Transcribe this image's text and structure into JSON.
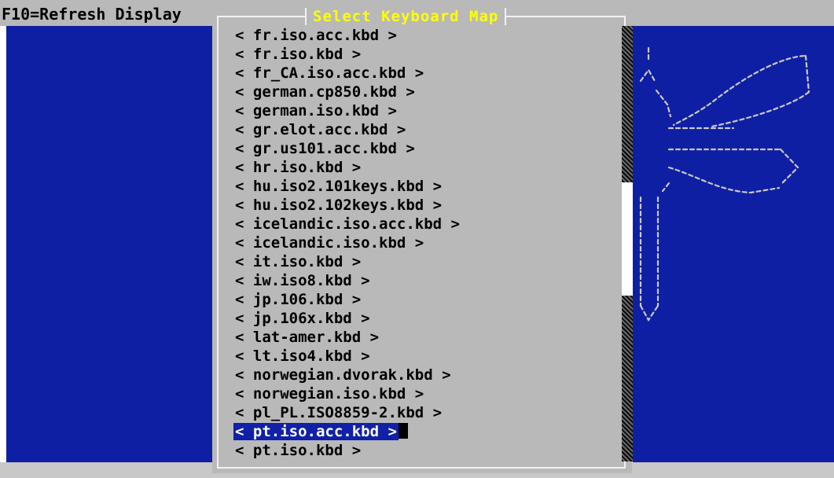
{
  "header": {
    "hint_text": "F10=Refresh Display"
  },
  "dialog": {
    "title": "Select Keyboard Map",
    "items": [
      "< fr.iso.acc.kbd >",
      "< fr.iso.kbd >",
      "< fr_CA.iso.acc.kbd >",
      "< german.cp850.kbd >",
      "< german.iso.kbd >",
      "< gr.elot.acc.kbd >",
      "< gr.us101.acc.kbd >",
      "< hr.iso.kbd >",
      "< hu.iso2.101keys.kbd >",
      "< hu.iso2.102keys.kbd >",
      "< icelandic.iso.acc.kbd >",
      "< icelandic.iso.kbd >",
      "< it.iso.kbd >",
      "< iw.iso8.kbd >",
      "< jp.106.kbd >",
      "< jp.106x.kbd >",
      "< lat-amer.kbd >",
      "< lt.iso4.kbd >",
      "< norwegian.dvorak.kbd >",
      "< norwegian.iso.kbd >",
      "< pl_PL.ISO8859-2.kbd >",
      "< pt.iso.acc.kbd >",
      "< pt.iso.kbd >"
    ],
    "selected_index": 21,
    "scroll_position": 0.36,
    "scroll_visible_fraction": 0.26
  },
  "colors": {
    "background_blue": "#0f1fa4",
    "dialog_gray": "#b9b9b9",
    "title_yellow": "#ffff00",
    "selection_blue": "#1020a8"
  }
}
